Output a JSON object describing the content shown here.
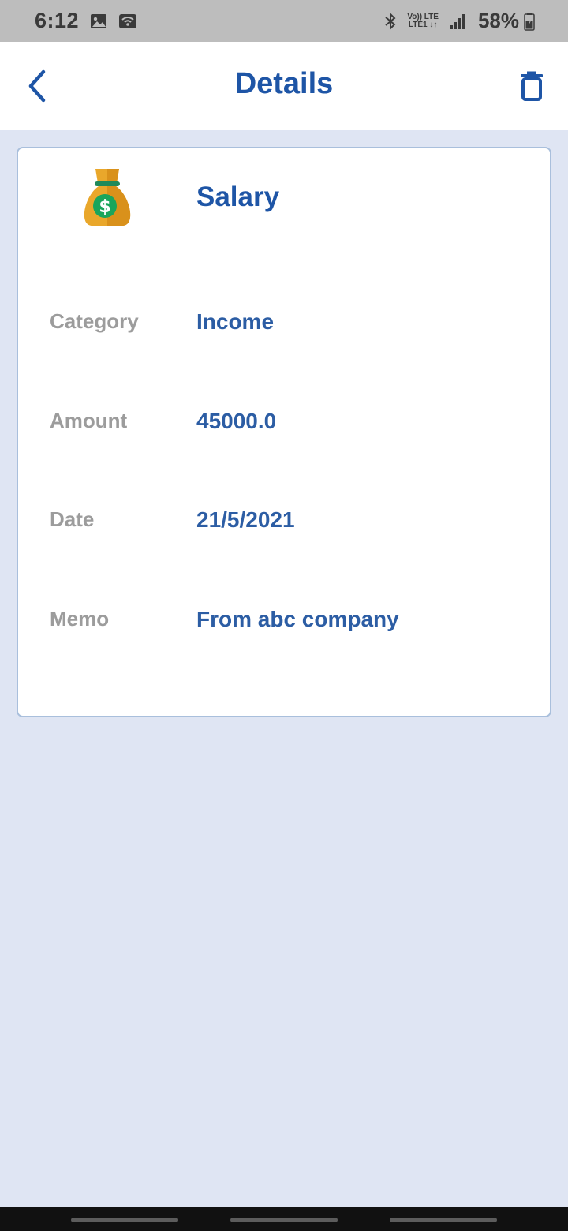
{
  "status_bar": {
    "time": "6:12",
    "network_top": "Vo)) LTE",
    "network_bottom": "LTE1 ↓↑",
    "battery": "58%",
    "icons": [
      "image-icon",
      "wifi-icon",
      "bluetooth-icon",
      "signal-icon",
      "battery-icon"
    ]
  },
  "app_bar": {
    "title": "Details",
    "back_icon": "back-chevron-icon",
    "delete_icon": "trash-icon"
  },
  "record": {
    "icon": "money-bag-icon",
    "title": "Salary",
    "fields": [
      {
        "label": "Category",
        "value": "Income"
      },
      {
        "label": "Amount",
        "value": "45000.0"
      },
      {
        "label": "Date",
        "value": "21/5/2021"
      },
      {
        "label": "Memo",
        "value": "From abc company"
      }
    ]
  },
  "colors": {
    "primary": "#1e55a6",
    "value_text": "#2c5da4",
    "label_text": "#9c9c9c",
    "background": "#dfe5f3",
    "card_border": "#a9bfdc",
    "bag_gold": "#e9a72b",
    "coin_green": "#1aa55b"
  }
}
